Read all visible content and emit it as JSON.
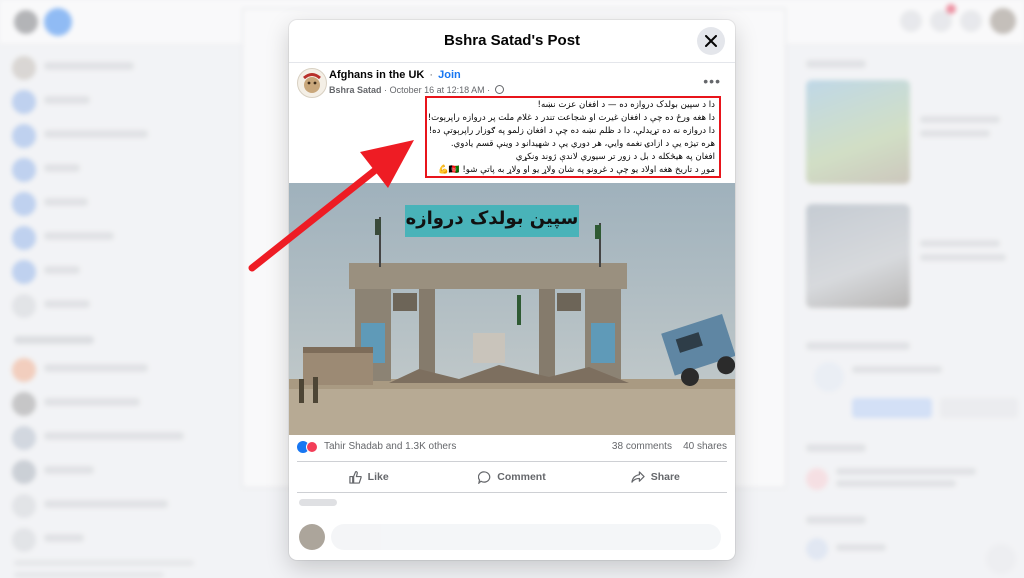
{
  "modal": {
    "title": "Bshra Satad's Post",
    "close_icon": "close-icon"
  },
  "post": {
    "group_name": "Afghans in the UK",
    "separator": "·",
    "join_label": "Join",
    "author": "Bshra Satad",
    "timestamp": "October 16 at 12:18 AM",
    "more_icon": "more-horizontal-icon",
    "text_lines": [
      "دا د سپین بولدک دروازه ده — د افغان عزت نښه!",
      "دا هغه ورځ ده چې د افغان غیرت او شجاعت تندر د غلام ملت پر دروازه راپرېوت!",
      "دا دروازه نه ده تړیدلې، دا د ظلم نښه ده چې د افغان زلمو په ګوزار راپرېوتې ده!",
      "هره تیژه یې د ازادۍ نغمه وايي، هر دوري یې د شهیدانو د وینې قسم یادوي.",
      "افغان په هیڅکله د بل د زور تر سیوري لاندې ژوند ونکړي",
      "موږ د تاریخ هغه اولاد یو چې د غرونو په شان ولاړ یو او ولاړ به پاتې شو! 🇦🇫💪"
    ],
    "image_caption": "سپین بولدک دروازه"
  },
  "reactions": {
    "names": "Tahir Shadab and 1.3K others",
    "comments": "38 comments",
    "shares": "40 shares"
  },
  "actions": {
    "like_label": "Like",
    "comment_label": "Comment",
    "share_label": "Share"
  },
  "colors": {
    "facebook_blue": "#1877f2",
    "highlight_red": "#e8141b",
    "arrow_red": "#ee1c24"
  }
}
